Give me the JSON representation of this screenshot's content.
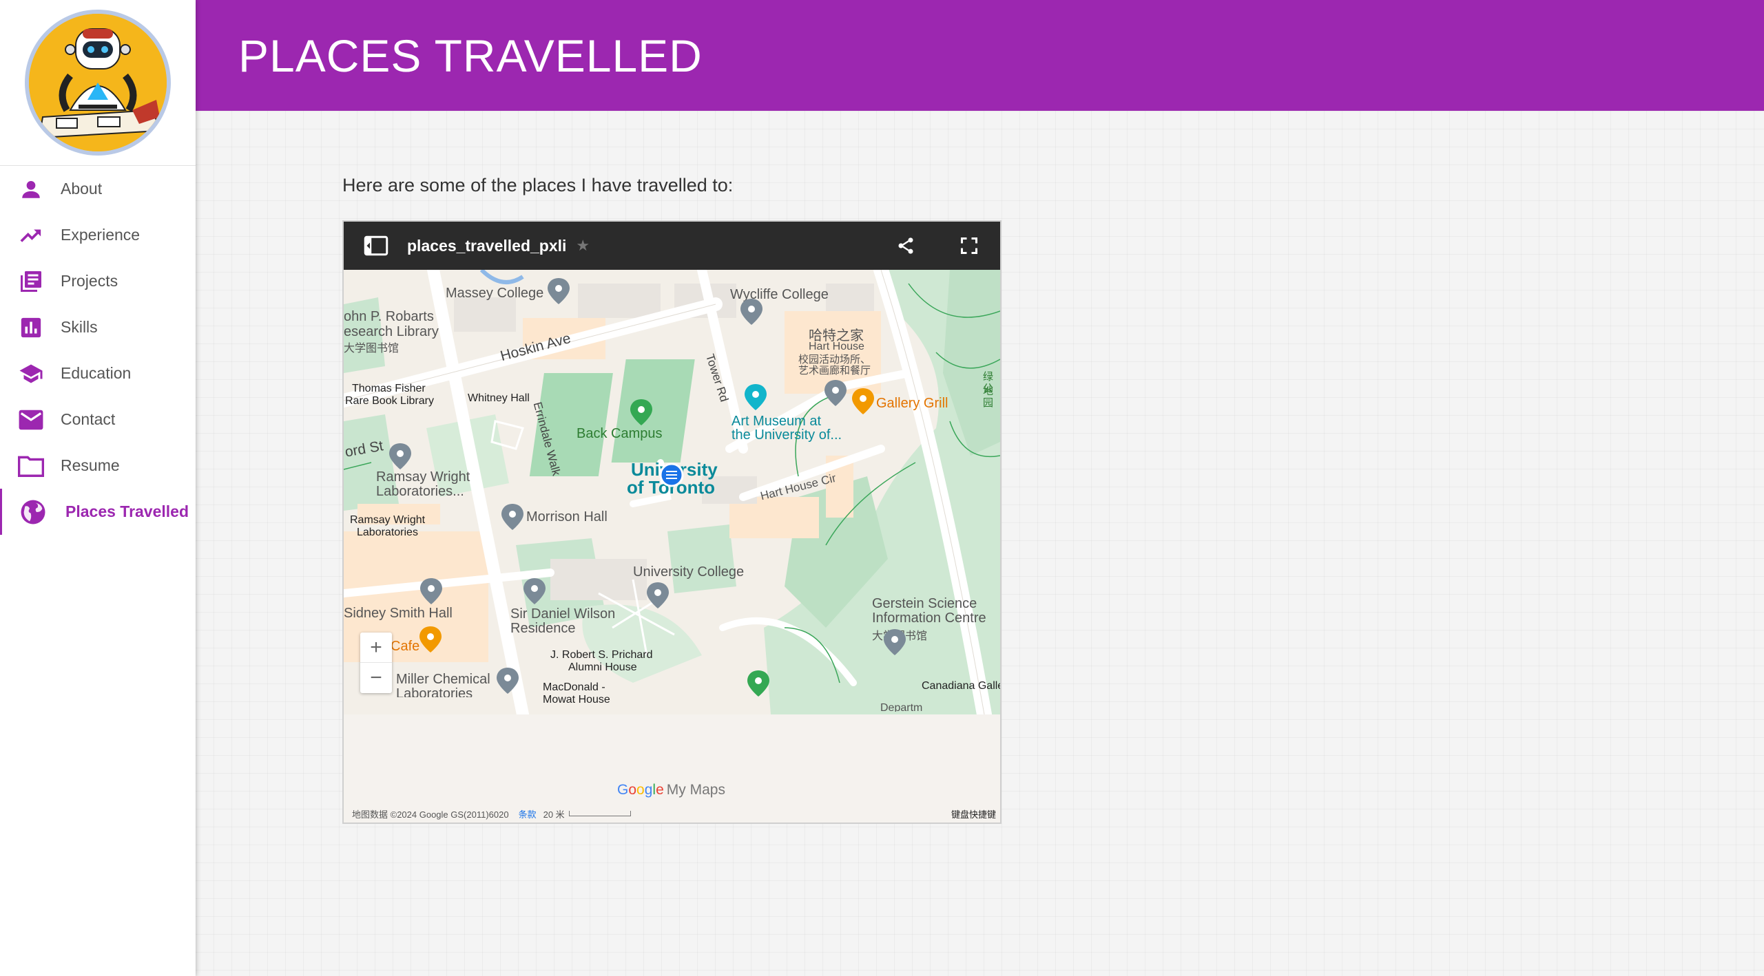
{
  "sidebar": {
    "items": [
      {
        "label": "About",
        "icon": "person-icon"
      },
      {
        "label": "Experience",
        "icon": "trending-up-icon"
      },
      {
        "label": "Projects",
        "icon": "library-books-icon"
      },
      {
        "label": "Skills",
        "icon": "bar-chart-icon"
      },
      {
        "label": "Education",
        "icon": "school-icon"
      },
      {
        "label": "Contact",
        "icon": "mail-icon"
      },
      {
        "label": "Resume",
        "icon": "folder-icon"
      },
      {
        "label": "Places Travelled",
        "icon": "globe-icon",
        "active": true
      }
    ]
  },
  "header": {
    "title": "PLACES TRAVELLED"
  },
  "main": {
    "intro": "Here are some of the places I have travelled to:"
  },
  "map": {
    "title": "places_travelled_pxli",
    "labels": {
      "massey": "Massey College",
      "wycliffe": "Wycliffe College",
      "robarts1": "ohn P. Robarts",
      "robarts2": "esearch Library",
      "robarts_cn": "大学图书馆",
      "hart_cn": "哈特之家",
      "hart_en": "Hart House",
      "hart_cn2": "校园活动场所、",
      "hart_cn3": "艺术画廊和餐厅",
      "hoskin": "Hoskin Ave",
      "tower": "Tower Rd",
      "fisher1": "Thomas Fisher",
      "fisher2": "Rare Book Library",
      "whitney": "Whitney Hall",
      "errindale": "Errindale Walk",
      "back_campus": "Back Campus",
      "art1": "Art Museum at",
      "art2": "the University of...",
      "gallery": "Gallery Grill",
      "green_cn": "绿地",
      "green_cn2": "公园",
      "ord": "ord St",
      "uoft1": "University",
      "uoft2": "of Toronto",
      "ramsay1": "Ramsay Wright",
      "ramsay2": "Laboratories...",
      "ramsay3": "Ramsay Wright",
      "ramsay4": "Laboratories",
      "morrison": "Morrison Hall",
      "hart_circ": "Hart House Cir",
      "uc": "University College",
      "sidney": "Sidney Smith Hall",
      "wilson1": "Sir Daniel Wilson",
      "wilson2": "Residence",
      "gerstein1": "Gerstein Science",
      "gerstein2": "Information Centre",
      "gerstein_cn": "大学图书馆",
      "cafe": "Cafe",
      "prichard1": "J. Robert S. Prichard",
      "prichard2": "Alumni House",
      "miller1": "Miller Chemical",
      "miller2": "Laboratories",
      "macdonald": "MacDonald -",
      "mowat": "Mowat House",
      "canadiana": "Canadiana Galle",
      "depart": "Departm"
    },
    "brand_letters": [
      "G",
      "o",
      "o",
      "g",
      "l",
      "e"
    ],
    "brand_suffix": "My Maps",
    "attribution": "地图数据 ©2024 Google GS(2011)6020",
    "terms": "条款",
    "scale": "20 米",
    "keyboard": "键盘快捷键",
    "zoom_in": "+",
    "zoom_out": "−"
  },
  "colors": {
    "accent": "#9c27b0",
    "avatar_bg": "#f5b61b",
    "avatar_ring": "#b9c9e6",
    "map_bar": "#2b2b2b",
    "park_green": "#a8dab5",
    "pin_gray": "#7b8a97",
    "pin_green": "#34a853",
    "pin_teal": "#12b5cb",
    "pin_orange": "#f29900",
    "pin_blue": "#1a73e8"
  }
}
